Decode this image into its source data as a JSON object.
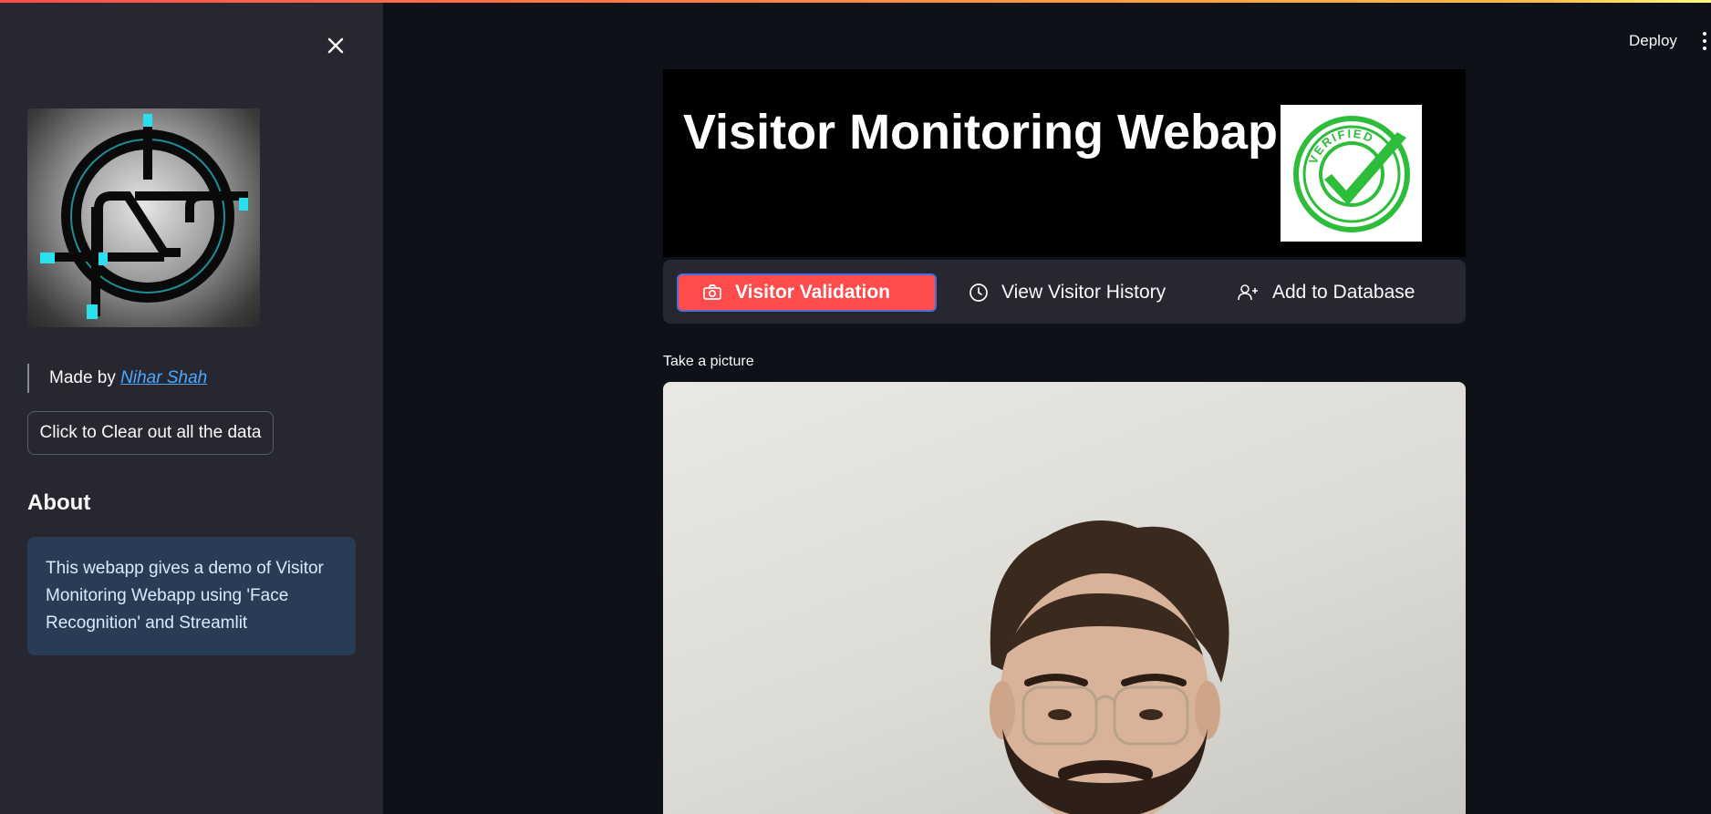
{
  "header": {
    "deploy_label": "Deploy",
    "accent_stripe_colors": [
      "#ff4b4b",
      "#ffbd45",
      "#fffd80"
    ]
  },
  "sidebar": {
    "close_icon": "close-icon",
    "logo_text": "NS",
    "made_by_prefix": "Made by",
    "made_by_link": "Nihar Shah",
    "clear_button_label": "Click to Clear out all the data",
    "about_heading": "About",
    "about_text": "This webapp gives a demo of Visitor Monitoring Webapp using 'Face Recognition' and Streamlit"
  },
  "main": {
    "banner_title": "Visitor Monitoring Webapp",
    "badge_text": "VERIFIED",
    "nav": [
      {
        "label": "Visitor Validation",
        "icon": "camera-icon",
        "active": true
      },
      {
        "label": "View Visitor History",
        "icon": "clock-icon",
        "active": false
      },
      {
        "label": "Add to Database",
        "icon": "add-user-icon",
        "active": false
      }
    ],
    "camera_label": "Take a picture"
  },
  "colors": {
    "background": "#0e1117",
    "sidebar": "#262730",
    "accent": "#ff4b4b",
    "info_box": "#293b55",
    "link": "#4ea8ff",
    "verified_green": "#2ebd3a"
  }
}
